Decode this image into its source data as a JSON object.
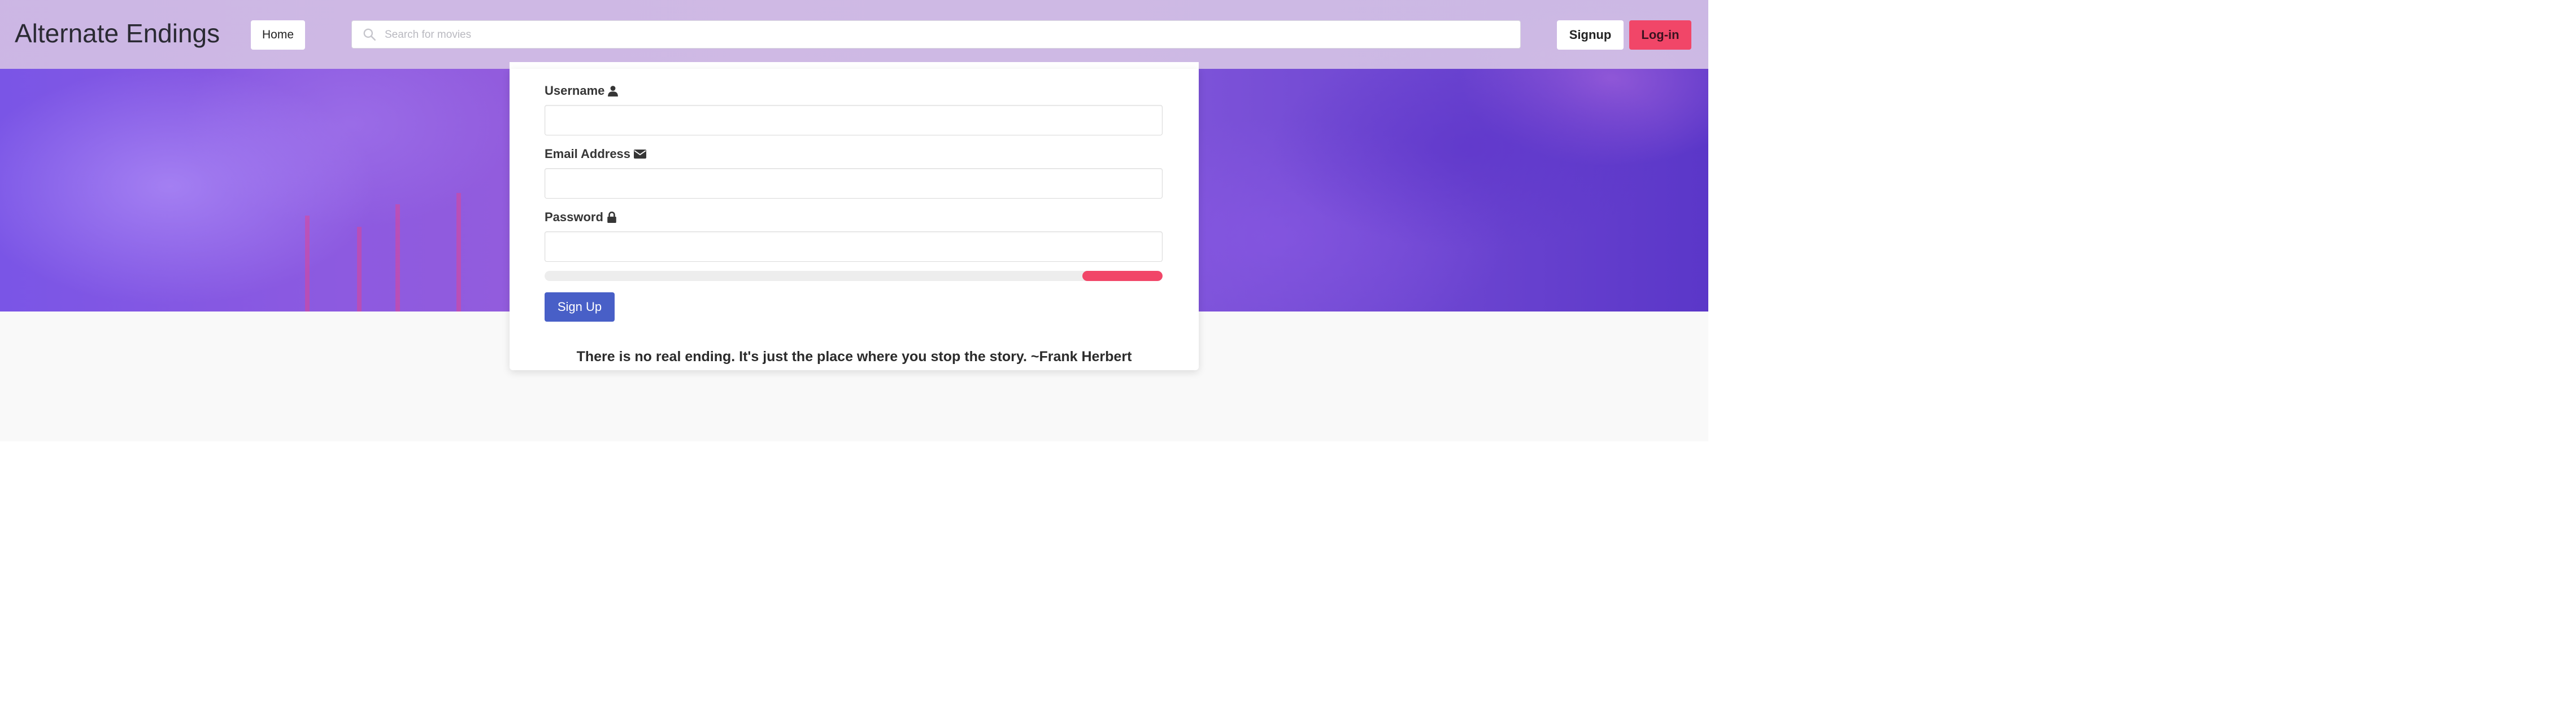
{
  "navbar": {
    "brand": "Alternate Endings",
    "home_label": "Home",
    "search_placeholder": "Search for movies",
    "signup_label": "Signup",
    "login_label": "Log-in"
  },
  "form": {
    "username_label": "Username",
    "email_label": "Email Address",
    "password_label": "Password",
    "strength_fraction": 0.13,
    "submit_label": "Sign Up"
  },
  "quote": "There is no real ending. It's just the place where you stop the story. ~Frank Herbert",
  "icons": {
    "username": "user-icon",
    "email": "envelope-icon",
    "password": "lock-icon",
    "search": "search-icon"
  },
  "colors": {
    "primary": "#485fc7",
    "danger": "#f14668",
    "hero": "#8d5ae0"
  }
}
